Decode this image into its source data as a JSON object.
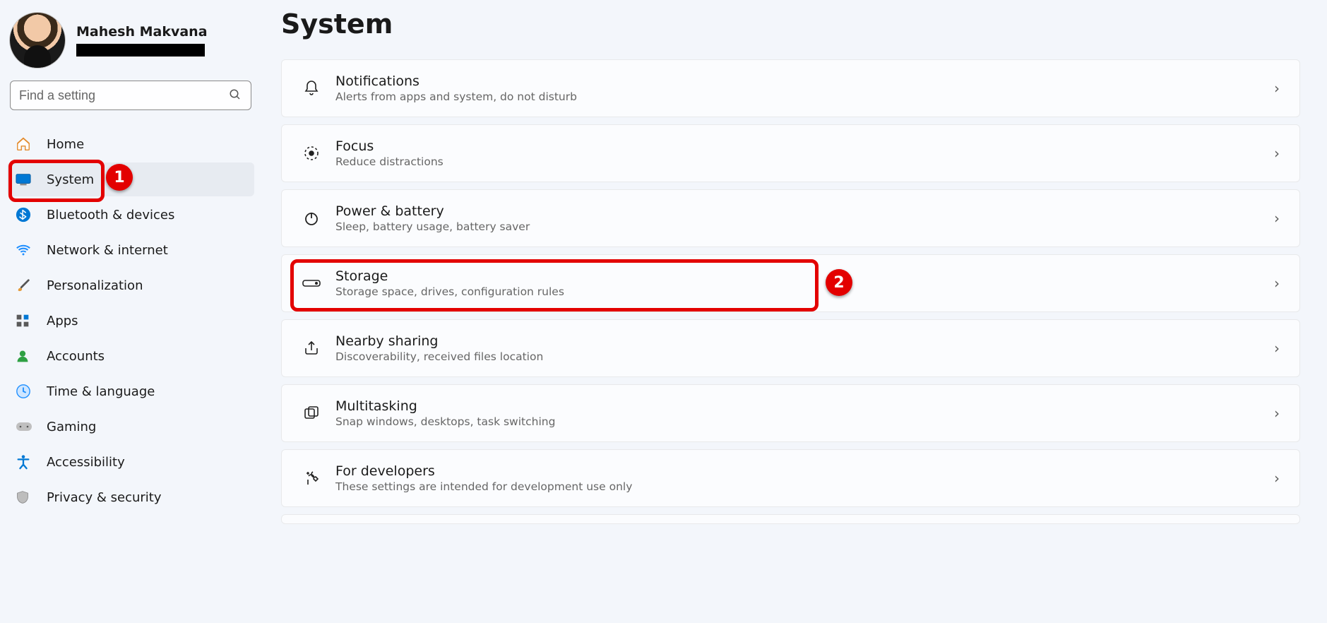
{
  "profile": {
    "name": "Mahesh Makvana"
  },
  "search": {
    "placeholder": "Find a setting"
  },
  "sidebar": {
    "items": [
      {
        "label": "Home"
      },
      {
        "label": "System"
      },
      {
        "label": "Bluetooth & devices"
      },
      {
        "label": "Network & internet"
      },
      {
        "label": "Personalization"
      },
      {
        "label": "Apps"
      },
      {
        "label": "Accounts"
      },
      {
        "label": "Time & language"
      },
      {
        "label": "Gaming"
      },
      {
        "label": "Accessibility"
      },
      {
        "label": "Privacy & security"
      }
    ]
  },
  "page": {
    "title": "System"
  },
  "cards": [
    {
      "title": "Notifications",
      "desc": "Alerts from apps and system, do not disturb"
    },
    {
      "title": "Focus",
      "desc": "Reduce distractions"
    },
    {
      "title": "Power & battery",
      "desc": "Sleep, battery usage, battery saver"
    },
    {
      "title": "Storage",
      "desc": "Storage space, drives, configuration rules"
    },
    {
      "title": "Nearby sharing",
      "desc": "Discoverability, received files location"
    },
    {
      "title": "Multitasking",
      "desc": "Snap windows, desktops, task switching"
    },
    {
      "title": "For developers",
      "desc": "These settings are intended for development use only"
    }
  ],
  "annotations": {
    "badge1": "1",
    "badge2": "2"
  }
}
